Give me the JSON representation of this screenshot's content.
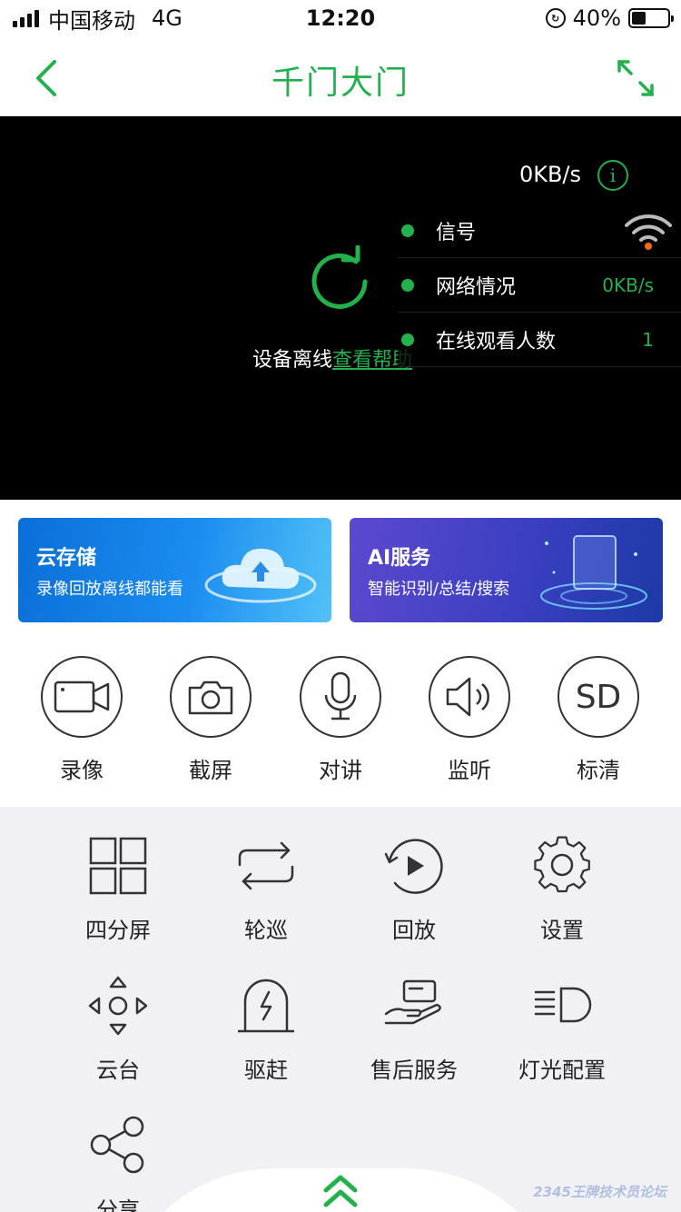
{
  "status_bar": {
    "carrier": "中国移动",
    "network": "4G",
    "time": "12:20",
    "battery": "40%"
  },
  "nav": {
    "title": "千门大门"
  },
  "video": {
    "speed": "0KB/s",
    "info_icon": "i",
    "offline_text": "设备离线",
    "help_link": "查看帮助",
    "stats": [
      {
        "label": "信号",
        "value": ""
      },
      {
        "label": "网络情况",
        "value": "0KB/s"
      },
      {
        "label": "在线观看人数",
        "value": "1"
      }
    ]
  },
  "banners": {
    "cloud": {
      "title": "云存储",
      "subtitle": "录像回放离线都能看"
    },
    "ai": {
      "title": "AI服务",
      "subtitle": "智能识别/总结/搜索"
    }
  },
  "controls": [
    {
      "label": "录像",
      "icon": "video-camera-icon"
    },
    {
      "label": "截屏",
      "icon": "camera-icon"
    },
    {
      "label": "对讲",
      "icon": "microphone-icon"
    },
    {
      "label": "监听",
      "icon": "speaker-icon"
    },
    {
      "label": "标清",
      "icon": "sd-icon",
      "text": "SD"
    }
  ],
  "grid": [
    {
      "label": "四分屏",
      "icon": "quad-screen-icon"
    },
    {
      "label": "轮巡",
      "icon": "loop-icon"
    },
    {
      "label": "回放",
      "icon": "playback-icon"
    },
    {
      "label": "设置",
      "icon": "gear-icon"
    },
    {
      "label": "云台",
      "icon": "ptz-icon"
    },
    {
      "label": "驱赶",
      "icon": "deter-icon"
    },
    {
      "label": "售后服务",
      "icon": "service-icon"
    },
    {
      "label": "灯光配置",
      "icon": "light-icon"
    },
    {
      "label": "分享",
      "icon": "share-icon"
    }
  ],
  "watermark": "2345王牌技术员论坛",
  "colors": {
    "accent": "#22b14c",
    "video_bg": "#000000",
    "page_bg": "#f1f1f5"
  }
}
